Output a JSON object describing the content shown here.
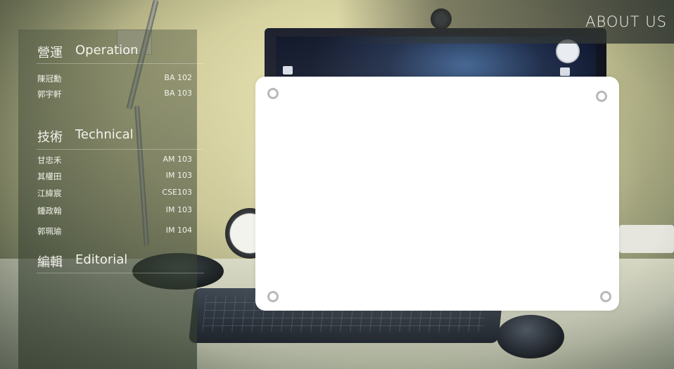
{
  "header": {
    "nav_label": "ABOUT US"
  },
  "sections": [
    {
      "zh": "營運",
      "en": "Operation",
      "members": [
        {
          "name": "陳冠勳",
          "dept": "BA 102"
        },
        {
          "name": "郭宇軒",
          "dept": "BA 103"
        }
      ]
    },
    {
      "zh": "技術",
      "en": "Technical",
      "members": [
        {
          "name": "甘忠禾",
          "dept": "AM 103"
        },
        {
          "name": "其權田",
          "dept": "IM 103"
        },
        {
          "name": "江緯宸",
          "dept": "CSE103"
        },
        {
          "name": "鍾政翰",
          "dept": "IM 103"
        },
        {
          "name": "郭珮瑜",
          "dept": "IM 104"
        }
      ]
    },
    {
      "zh": "編輯",
      "en": "Editorial",
      "members": []
    }
  ],
  "colors": {
    "overlay_text": "#f3f3ec",
    "card_background": "#ffffff",
    "pin_ring": "#b9b9b9"
  }
}
